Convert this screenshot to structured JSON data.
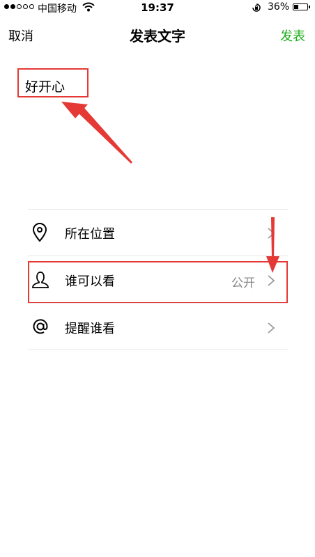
{
  "status_bar": {
    "carrier": "中国移动",
    "time": "19:37",
    "battery": "36%",
    "battery_level": 0.36
  },
  "nav": {
    "cancel": "取消",
    "title": "发表文字",
    "publish": "发表"
  },
  "post": {
    "text": "好开心"
  },
  "options": [
    {
      "label": "所在位置",
      "value": "",
      "icon": "location-pin-icon"
    },
    {
      "label": "谁可以看",
      "value": "公开",
      "icon": "person-icon"
    },
    {
      "label": "提醒谁看",
      "value": "",
      "icon": "at-sign-icon"
    }
  ],
  "colors": {
    "accent": "#1aad19",
    "annotation": "#e53935"
  }
}
